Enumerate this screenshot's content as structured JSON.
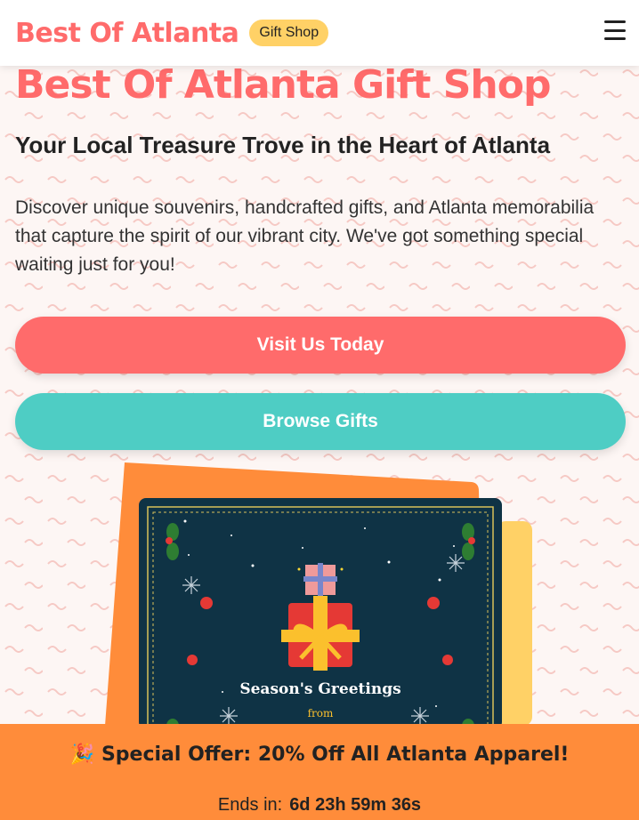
{
  "header": {
    "brand": "Best Of Atlanta",
    "badge": "Gift Shop",
    "menu_icon": "hamburger-menu-icon"
  },
  "hero": {
    "title": "Best Of Atlanta Gift Shop",
    "subtitle": "Your Local Treasure Trove in the Heart of Atlanta",
    "description": "Discover unique souvenirs, handcrafted gifts, and Atlanta memorabilia that capture the spirit of our vibrant city. We've got something special waiting just for you!"
  },
  "buttons": {
    "visit": "Visit Us Today",
    "browse": "Browse Gifts"
  },
  "card": {
    "greeting": "Season's Greetings",
    "from": "from"
  },
  "offer": {
    "icon": "party-popper-icon",
    "text": "Special Offer: 20% Off All Atlanta Apparel!",
    "ends_label": "Ends in:",
    "countdown": "6d 23h 59m 36s"
  },
  "colors": {
    "accent": "#ff6b6b",
    "teal": "#4ecdc4",
    "badge": "#ffd166",
    "offer": "#ff8c3a",
    "card_bg": "#0f3345"
  }
}
